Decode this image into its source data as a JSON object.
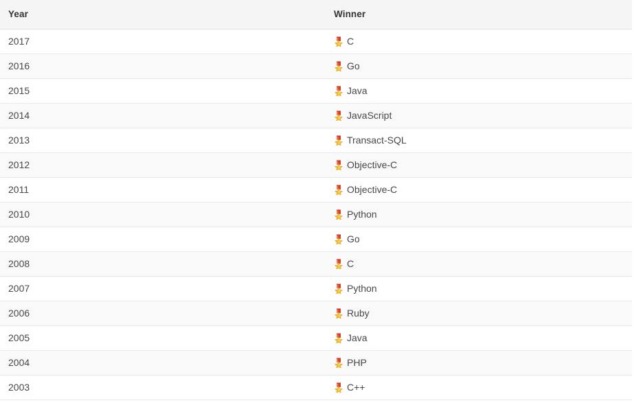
{
  "table": {
    "columns": [
      {
        "key": "year",
        "label": "Year"
      },
      {
        "key": "winner",
        "label": "Winner"
      }
    ],
    "icon": {
      "name": "medal-icon",
      "glyph": "🎖",
      "ribbon_color": "#d93f2b",
      "ribbon_highlight": "#f07a5a",
      "star_color": "#f2c232",
      "star_outline": "#d99b1d"
    },
    "rows": [
      {
        "year": "2017",
        "winner": "C"
      },
      {
        "year": "2016",
        "winner": "Go"
      },
      {
        "year": "2015",
        "winner": "Java"
      },
      {
        "year": "2014",
        "winner": "JavaScript"
      },
      {
        "year": "2013",
        "winner": "Transact-SQL"
      },
      {
        "year": "2012",
        "winner": "Objective-C"
      },
      {
        "year": "2011",
        "winner": "Objective-C"
      },
      {
        "year": "2010",
        "winner": "Python"
      },
      {
        "year": "2009",
        "winner": "Go"
      },
      {
        "year": "2008",
        "winner": "C"
      },
      {
        "year": "2007",
        "winner": "Python"
      },
      {
        "year": "2006",
        "winner": "Ruby"
      },
      {
        "year": "2005",
        "winner": "Java"
      },
      {
        "year": "2004",
        "winner": "PHP"
      },
      {
        "year": "2003",
        "winner": "C++"
      }
    ]
  },
  "colors": {
    "page_background": "#ffffff",
    "header_background": "#f5f5f5",
    "row_odd_background": "#ffffff",
    "row_even_background": "#f9f9f9",
    "row_border": "#e9e9e9",
    "header_text": "#333333",
    "body_text": "#474747"
  }
}
